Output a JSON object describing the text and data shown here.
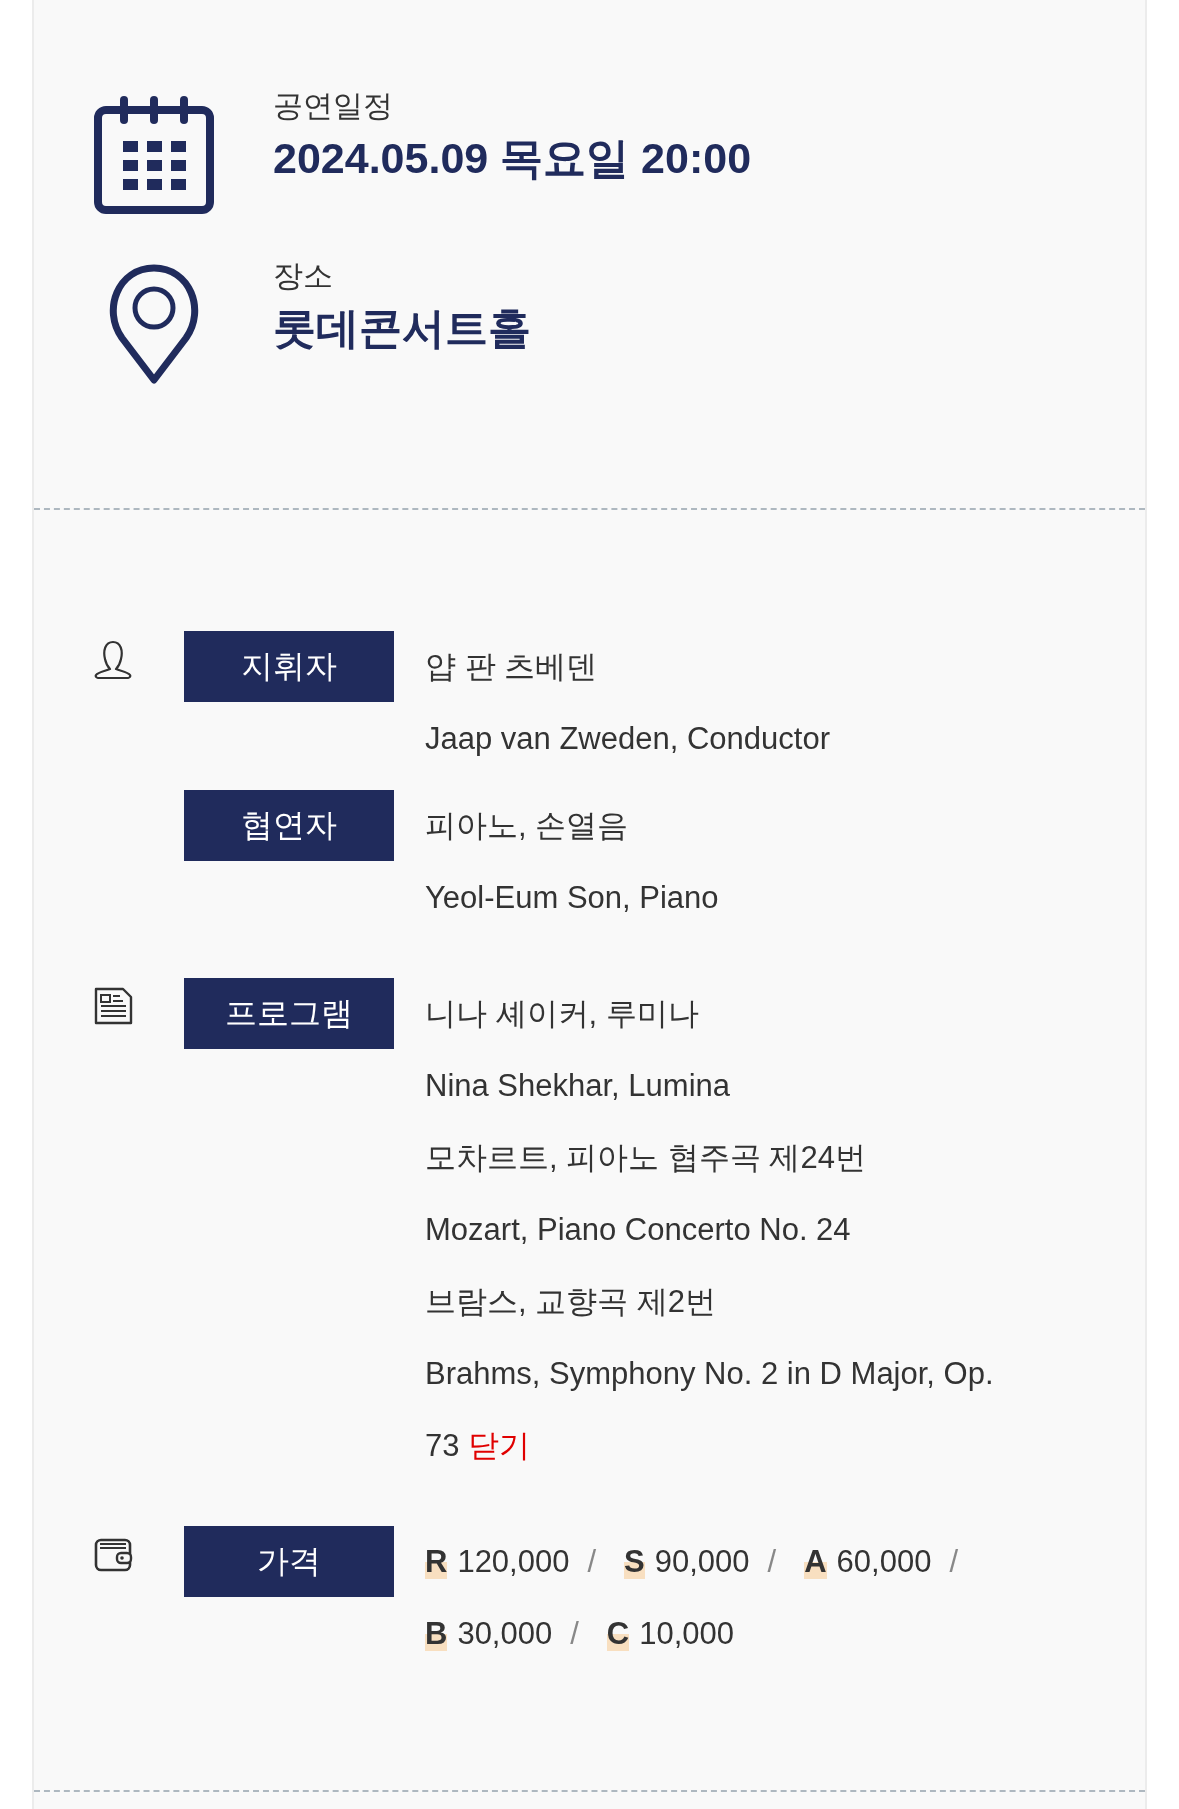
{
  "schedule": [
    {
      "kind": "date",
      "label": "공연일정",
      "value": "2024.05.09 목요일 20:00"
    },
    {
      "kind": "place",
      "label": "장소",
      "value": "롯데콘서트홀"
    }
  ],
  "details": [
    {
      "kind": "person",
      "entries": [
        {
          "label": "지휘자",
          "lines": [
            "얍 판 츠베덴",
            "Jaap van Zweden, Conductor"
          ]
        },
        {
          "label": "협연자",
          "lines": [
            "피아노, 손열음",
            "Yeol-Eum Son, Piano"
          ]
        }
      ]
    },
    {
      "kind": "document",
      "entries": [
        {
          "label": "프로그램",
          "lines": [
            "니나 셰이커, 루미나",
            "Nina Shekhar, Lumina",
            "모차르트, 피아노 협주곡 제24번",
            "Mozart, Piano Concerto No. 24",
            "브람스, 교향곡 제2번",
            "Brahms, Symphony No. 2 in D Major, Op.",
            "73"
          ],
          "close_link": "닫기"
        }
      ]
    },
    {
      "kind": "wallet",
      "entries": [
        {
          "label": "가격",
          "separator": "/",
          "prices": [
            {
              "grade": "R",
              "amount": "120,000"
            },
            {
              "grade": "S",
              "amount": "90,000"
            },
            {
              "grade": "A",
              "amount": "60,000"
            },
            {
              "grade": "B",
              "amount": "30,000"
            },
            {
              "grade": "C",
              "amount": "10,000"
            }
          ]
        }
      ]
    }
  ]
}
